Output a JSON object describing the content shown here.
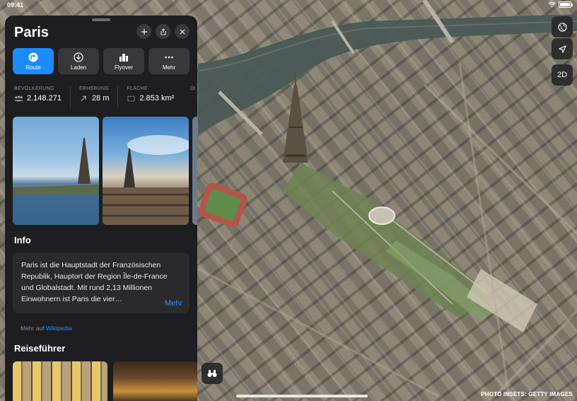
{
  "status": {
    "time": "09:41"
  },
  "panel": {
    "title": "Paris",
    "actions": [
      {
        "label": "Route",
        "icon": "route-arrow-icon"
      },
      {
        "label": "Laden",
        "icon": "download-icon"
      },
      {
        "label": "Flyover",
        "icon": "buildings-icon"
      },
      {
        "label": "Mehr",
        "icon": "more-dots-icon"
      }
    ],
    "stats": [
      {
        "label": "BEVÖLKERUNG",
        "value": "2.148.271",
        "icon": "people-icon"
      },
      {
        "label": "ERHEBUNG",
        "value": "28 m",
        "icon": "elevation-arrow-icon"
      },
      {
        "label": "FLÄCHE",
        "value": "2.853 km²",
        "icon": "area-icon"
      }
    ],
    "stats_overflow_label": "DI",
    "info": {
      "heading": "Info",
      "text": "Paris ist die Hauptstadt der Französischen Republik, Hauptort der Region Île-de-France und Globalstadt. Mit rund 2,13 Millionen Einwohnern ist Paris die vier…",
      "more_label": "Mehr",
      "source_prefix": "Mehr auf",
      "source_link": "Wikipedia"
    },
    "guides_heading": "Reiseführer"
  },
  "map_controls": {
    "globe": "globe-icon",
    "location": "location-arrow-icon",
    "mode_label": "2D"
  },
  "credit": "PHOTO INSETS: GETTY IMAGES",
  "colors": {
    "accent": "#1a8cff",
    "panel_bg": "#1e1e20",
    "link": "#2f8cff"
  }
}
